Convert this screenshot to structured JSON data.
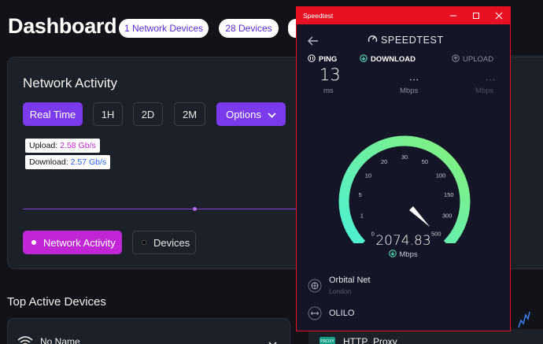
{
  "dashboard": {
    "title": "Dashboard",
    "pills": [
      "1 Network Devices",
      "28 Devices",
      ""
    ],
    "panel_title": "Network Activity",
    "range_buttons": [
      "Real Time",
      "1H",
      "2D",
      "2M"
    ],
    "options_label": "Options",
    "tooltip": {
      "upload_label": "Upload:",
      "upload_value": "2.58 Gb/s",
      "download_label": "Download:",
      "download_value": "2.57 Gb/s"
    },
    "legend": [
      "Network Activity",
      "Devices"
    ],
    "section_title": "Top Active Devices",
    "device_name": "No Name",
    "proxy_label": "HTTP_Proxy",
    "proxy_badge": "PROXY",
    "colors": {
      "accent": "#7c3aed",
      "magenta": "#c026d3",
      "bg": "#111318",
      "panel": "#1c2029"
    }
  },
  "speedtest": {
    "window_title": "Speedtest",
    "brand": "SPEEDTEST",
    "ping": {
      "label": "PING",
      "value": "13",
      "unit": "ms"
    },
    "download": {
      "label": "DOWNLOAD",
      "value": "...",
      "unit": "Mbps"
    },
    "upload": {
      "label": "UPLOAD",
      "value": "...",
      "unit": "Mbps"
    },
    "gauge": {
      "ticks": [
        "0",
        "1",
        "5",
        "10",
        "20",
        "30",
        "50",
        "100",
        "150",
        "300",
        "500"
      ],
      "needle_value": 500,
      "colors": {
        "start": "#5ef0c8",
        "end": "#7ef07a"
      }
    },
    "current_speed": "2074.83",
    "current_unit": "Mbps",
    "isp": {
      "name": "Orbital Net",
      "location": "London"
    },
    "server": {
      "name": "OLILO"
    },
    "colors": {
      "titlebar": "#e81123",
      "bg": "#141526"
    }
  }
}
